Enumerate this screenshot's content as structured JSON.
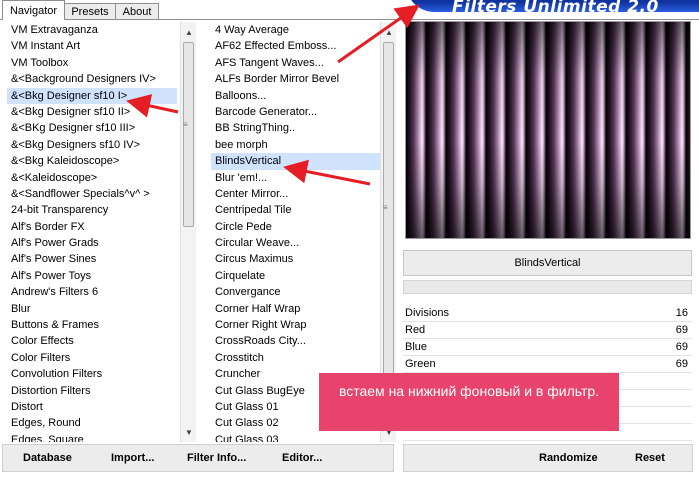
{
  "tabs": [
    {
      "label": "Navigator",
      "active": true
    },
    {
      "label": "Presets",
      "active": false
    },
    {
      "label": "About",
      "active": false
    }
  ],
  "categories": [
    "VM Extravaganza",
    "VM Instant Art",
    "VM Toolbox",
    "&<Background Designers IV>",
    "&<Bkg Designer sf10 I>",
    "&<Bkg Designer sf10 II>",
    "&<BKg Designer sf10 III>",
    "&<Bkg Designers sf10 IV>",
    "&<Bkg Kaleidoscope>",
    "&<Kaleidoscope>",
    "&<Sandflower Specials^v^ >",
    "24-bit Transparency",
    "Alf's Border FX",
    "Alf's Power Grads",
    "Alf's Power Sines",
    "Alf's Power Toys",
    "Andrew's Filters 6",
    "Blur",
    "Buttons & Frames",
    "Color Effects",
    "Color Filters",
    "Convolution Filters",
    "Distortion Filters",
    "Distort",
    "Edges, Round",
    "Edges, Square"
  ],
  "selected_category": "&<Bkg Designer sf10 I>",
  "filters": [
    "4 Way Average",
    "AF62 Effected Emboss...",
    "AFS Tangent Waves...",
    "ALFs Border Mirror Bevel",
    "Balloons...",
    "Barcode Generator...",
    "BB StringThing..",
    "bee morph",
    "BlindsVertical",
    "Blur 'em!...",
    "Center Mirror...",
    "Centripedal Tile",
    "Circle Pede",
    "Circular Weave...",
    "Circus Maximus",
    "Cirquelate",
    "Convergance",
    "Corner Half Wrap",
    "Corner Right Wrap",
    "CrossRoads City...",
    "Crosstitch",
    "Cruncher",
    "Cut Glass  BugEye",
    "Cut Glass 01",
    "Cut Glass 02",
    "Cut Glass 03"
  ],
  "selected_filter": "BlindsVertical",
  "filter_name": "BlindsVertical",
  "params": [
    {
      "name": "Divisions",
      "value": "16"
    },
    {
      "name": "Red",
      "value": "69"
    },
    {
      "name": "Blue",
      "value": "69"
    },
    {
      "name": "Green",
      "value": "69"
    }
  ],
  "bottom_left": {
    "database": "Database",
    "import": "Import...",
    "filter_info": "Filter Info...",
    "editor": "Editor..."
  },
  "bottom_right": {
    "randomize": "Randomize",
    "reset": "Reset"
  },
  "logo_text": "Filters Unlimited 2.0",
  "note_text": "встаем на нижний фоновый и в фильтр.",
  "colors": {
    "note_bg": "#e8436c",
    "arrow": "#e51e25",
    "logo_bg": "#10329f",
    "preview_stripe": "#e8cce8"
  }
}
